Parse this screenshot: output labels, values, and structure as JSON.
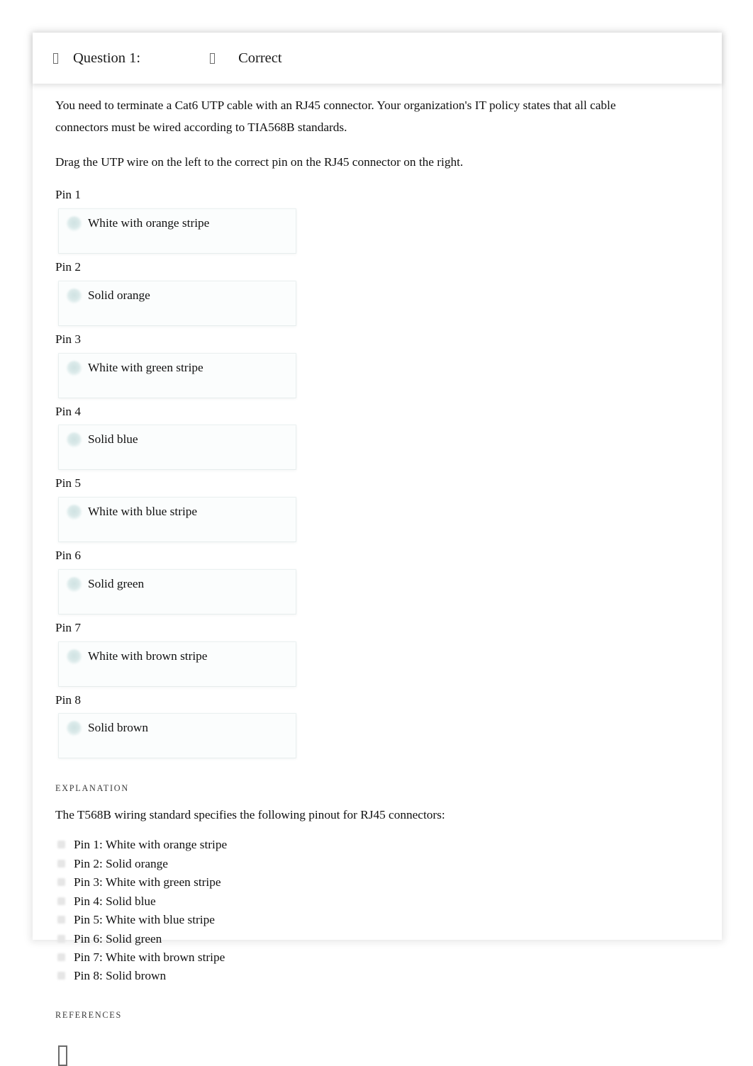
{
  "header": {
    "question_icon": "missing-glyph-box",
    "question_label": "Question 1:",
    "status_icon": "missing-glyph-box",
    "status_label": "Correct"
  },
  "body": {
    "prompt": "You need to terminate a Cat6 UTP cable with an RJ45 connector. Your organization's IT policy states that all cable connectors must be wired according to TIA568B standards.",
    "instruction": "Drag the UTP wire on the left to the correct pin on the RJ45 connector on the right."
  },
  "pins": [
    {
      "label": "Pin 1",
      "wire": "White with orange stripe"
    },
    {
      "label": "Pin 2",
      "wire": "Solid orange"
    },
    {
      "label": "Pin 3",
      "wire": "White with green stripe"
    },
    {
      "label": "Pin 4",
      "wire": "Solid blue"
    },
    {
      "label": "Pin 5",
      "wire": "White with blue stripe"
    },
    {
      "label": "Pin 6",
      "wire": "Solid green"
    },
    {
      "label": "Pin 7",
      "wire": "White with brown stripe"
    },
    {
      "label": "Pin 8",
      "wire": "Solid brown"
    }
  ],
  "explanation": {
    "heading": "EXPLANATION",
    "intro": "The T568B wiring standard specifies the following pinout for RJ45 connectors:",
    "pinout": [
      "Pin 1: White with orange stripe",
      "Pin 2: Solid orange",
      "Pin 3: White with green stripe",
      "Pin 4: Solid blue",
      "Pin 5: White with blue stripe",
      "Pin 6: Solid green",
      "Pin 7: White with brown stripe",
      "Pin 8: Solid brown"
    ]
  },
  "references": {
    "heading": "REFERENCES",
    "icon": "missing-glyph-box"
  },
  "colors": {
    "page_background": "#ffffff",
    "card_background": "#fbfdfd",
    "wire_dot": "#dbeaea",
    "bullet": "#e6e6e6",
    "text": "#111111"
  }
}
